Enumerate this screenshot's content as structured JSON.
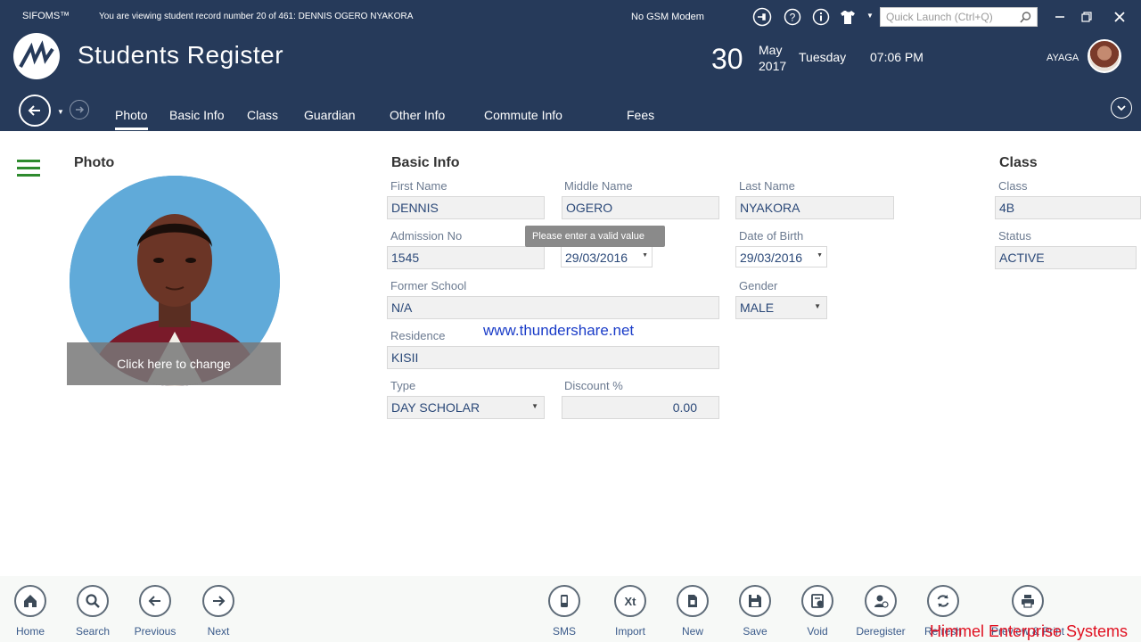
{
  "window": {
    "app_name": "SIFOMS™",
    "record_info": "You are viewing student record number 20 of 461: DENNIS OGERO NYAKORA",
    "gsm_status": "No GSM Modem",
    "quick_launch_placeholder": "Quick Launch (Ctrl+Q)",
    "icons": [
      "plug-icon",
      "help-icon",
      "info-icon",
      "shirt-icon",
      "search-icon",
      "minimize-icon",
      "restore-icon",
      "close-icon"
    ]
  },
  "header": {
    "title": "Students Register",
    "day": "30",
    "month": "May",
    "year": "2017",
    "weekday": "Tuesday",
    "time": "07:06 PM",
    "user": "AYAGA"
  },
  "tabs": [
    {
      "label": "Photo",
      "active": true
    },
    {
      "label": "Basic Info"
    },
    {
      "label": "Class"
    },
    {
      "label": "Guardian"
    },
    {
      "label": "Other Info"
    },
    {
      "label": "Commute Info"
    },
    {
      "label": "Fees"
    }
  ],
  "photo": {
    "heading": "Photo",
    "change_label": "Click here to change"
  },
  "basic_info": {
    "heading": "Basic Info",
    "first_name_label": "First Name",
    "first_name": "DENNIS",
    "middle_name_label": "Middle Name",
    "middle_name": "OGERO",
    "last_name_label": "Last Name",
    "last_name": "NYAKORA",
    "admission_no_label": "Admission No",
    "admission_no": "1545",
    "admission_date": "29/03/2016",
    "dob_label": "Date of Birth",
    "dob": "29/03/2016",
    "former_school_label": "Former School",
    "former_school": "N/A",
    "gender_label": "Gender",
    "gender": "MALE",
    "residence_label": "Residence",
    "residence": "KISII",
    "type_label": "Type",
    "type": "DAY SCHOLAR",
    "discount_label": "Discount %",
    "discount": "0.00",
    "tooltip": "Please enter a valid value"
  },
  "class_info": {
    "heading": "Class",
    "class_label": "Class",
    "class": "4B",
    "status_label": "Status",
    "status": "ACTIVE"
  },
  "watermark": "www.thundershare.net",
  "toolbar": [
    {
      "label": "Home",
      "icon": "home-icon"
    },
    {
      "label": "Search",
      "icon": "search-icon"
    },
    {
      "label": "Previous",
      "icon": "arrow-left-icon"
    },
    {
      "label": "Next",
      "icon": "arrow-right-icon"
    },
    {
      "label": "SMS",
      "icon": "sms-icon"
    },
    {
      "label": "Import",
      "icon": "import-icon"
    },
    {
      "label": "New",
      "icon": "new-document-icon"
    },
    {
      "label": "Save",
      "icon": "save-icon"
    },
    {
      "label": "Void",
      "icon": "void-icon"
    },
    {
      "label": "Deregister",
      "icon": "deregister-icon"
    },
    {
      "label": "Refresh",
      "icon": "refresh-icon"
    },
    {
      "label": "Preview & Print",
      "icon": "print-icon"
    }
  ],
  "brand": "Himmel Enterprise Systems"
}
